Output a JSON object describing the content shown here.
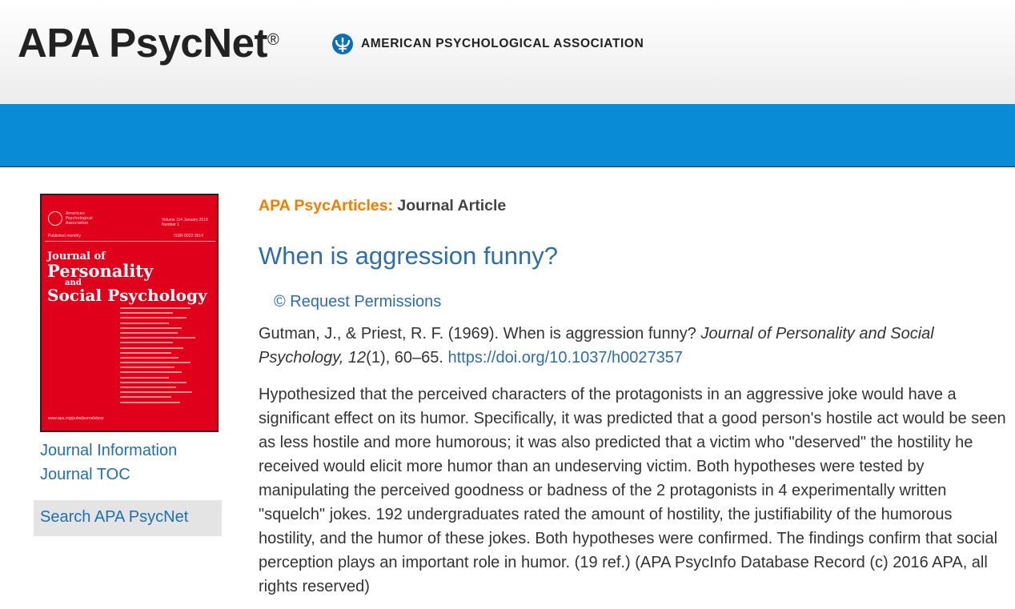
{
  "header": {
    "logo_text": "APA PsycNet",
    "logo_reg": "®",
    "brand_text": "AMERICAN PSYCHOLOGICAL ASSOCIATION"
  },
  "sidebar": {
    "cover": {
      "org": "American Psychological Association",
      "volume": "Volume 114 January 2018 Number 1",
      "published": "Published monthly",
      "issn": "ISSN 0022-3514",
      "title_line1": "Journal of",
      "title_line2": "Personality",
      "title_line3": "and",
      "title_line4": "Social Psychology",
      "url": "www.apa.org/pubs/journals/psp"
    },
    "links": [
      {
        "label": "Journal Information"
      },
      {
        "label": "Journal TOC"
      }
    ],
    "search_label": "Search APA PsycNet"
  },
  "article": {
    "source": "APA PsycArticles:",
    "type": "Journal Article",
    "title": "When is aggression funny?",
    "permissions": "© Request Permissions",
    "citation_authors": "Gutman, J., & Priest, R. F. (1969). When is aggression funny? ",
    "citation_journal": "Journal of Personality and Social Psychology, 12",
    "citation_issue_pages": "(1), 60–65. ",
    "doi": "https://doi.org/10.1037/h0027357",
    "abstract": "Hypothesized that the perceived characters of the protagonists in an aggressive joke would have a significant effect on its humor. Specifically, it was predicted that a good person's hostile act would be seen as less hostile and more humorous; it was also predicted that a victim who \"deserved\" the hostility he received would elicit more humor than an undeserving victim. Both hypotheses were tested by manipulating the perceived goodness or badness of the 2 protagonists in 4 experimentally written \"squelch\" jokes. 192 undergraduates rated the amount of hostility, the justifiability of the humorous hostility, and the humor of these jokes. Both hypotheses were confirmed. The findings confirm that social perception plays an important role in humor. (19 ref.) (APA PsycInfo Database Record (c) 2016 APA, all rights reserved)"
  },
  "colors": {
    "blue_bar": "#0a8bd6",
    "link_blue": "#2e6ea8",
    "orange": "#ef7d00",
    "cover_red": "#e0001b"
  }
}
